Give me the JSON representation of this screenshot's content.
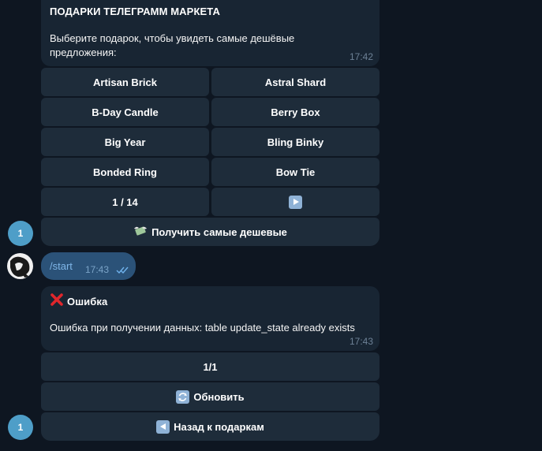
{
  "colors": {
    "background": "#0e1621",
    "bubble": "#182533",
    "keyboard_button": "#1e2c3a",
    "outgoing_bubble": "#2b5278",
    "time": "#6d8196",
    "badge": "#4e9ec8"
  },
  "msg1": {
    "title": "ПОДАРКИ ТЕЛЕГРАММ МАРКЕТА",
    "text_line1": "Выберите подарок, чтобы увидеть самые дешёвые",
    "text_line2": "предложения:",
    "time": "17:42"
  },
  "gifts": [
    {
      "label": "Artisan Brick"
    },
    {
      "label": "Astral Shard"
    },
    {
      "label": "B-Day Candle"
    },
    {
      "label": "Berry Box"
    },
    {
      "label": "Big Year"
    },
    {
      "label": "Bling Binky"
    },
    {
      "label": "Bonded Ring"
    },
    {
      "label": "Bow Tie"
    }
  ],
  "pagination": {
    "page": "1 / 14",
    "next_icon": "play-arrow-icon"
  },
  "cheapest_button": {
    "icon": "money-with-wings-icon",
    "label": "Получить самые дешевые"
  },
  "badge1": {
    "count": "1"
  },
  "outgoing": {
    "text": "/start",
    "time": "17:43",
    "status_icon": "double-check-icon"
  },
  "msg2": {
    "title_icon": "cross-mark-icon",
    "title": "Ошибка",
    "text": "Ошибка при получении данных: table update_state already exists",
    "time": "17:43"
  },
  "msg2_buttons": {
    "page": "1/1",
    "refresh": {
      "icon": "arrows-counterclockwise-icon",
      "label": "Обновить"
    },
    "back": {
      "icon": "reverse-arrow-icon",
      "label": "Назад к подаркам"
    }
  },
  "badge2": {
    "count": "1"
  }
}
